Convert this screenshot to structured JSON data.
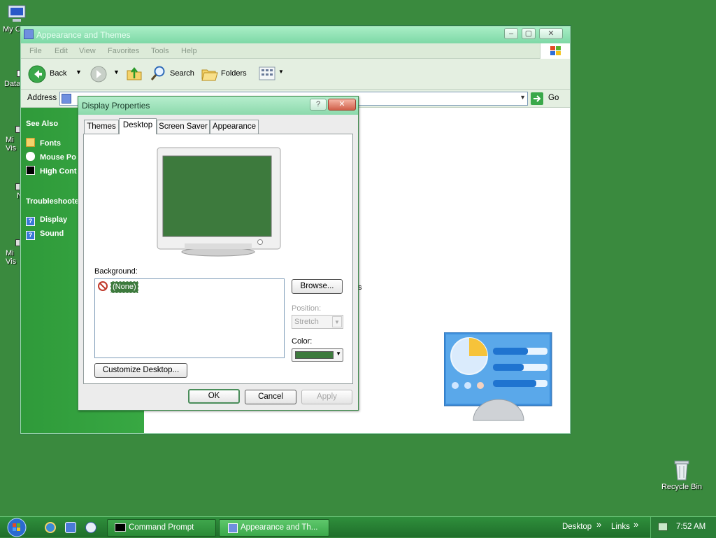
{
  "desktop": {
    "icons": [
      {
        "name": "my-computer",
        "label": "My C"
      },
      {
        "name": "data",
        "label": "Data"
      },
      {
        "name": "mi-1",
        "label": "Mi\nVis"
      },
      {
        "name": "n",
        "label": "N"
      },
      {
        "name": "mi-2",
        "label": "Mi\nVis"
      }
    ],
    "recycle_bin": "Recycle Bin",
    "background_color": "#3a8a3e"
  },
  "explorer": {
    "title": "Appearance and Themes",
    "menu": [
      "File",
      "Edit",
      "View",
      "Favorites",
      "Tools",
      "Help"
    ],
    "toolbar": {
      "back": "Back",
      "search": "Search",
      "folders": "Folders"
    },
    "address_label": "Address",
    "go_label": "Go",
    "see_also": {
      "heading": "See Also",
      "items": [
        "Fonts",
        "Mouse Po",
        "High Cont"
      ]
    },
    "troubleshooters": {
      "heading": "Troubleshoote",
      "items": [
        "Display",
        "Sound"
      ]
    },
    "stray_text": "s"
  },
  "dialog": {
    "title": "Display Properties",
    "help_btn": "?",
    "close_btn": "✕",
    "tabs": [
      "Themes",
      "Desktop",
      "Screen Saver",
      "Appearance"
    ],
    "selected_tab": "Desktop",
    "background_label": "Background:",
    "background_items": [
      "(None)"
    ],
    "browse": "Browse...",
    "position_label": "Position:",
    "position_value": "Stretch",
    "color_label": "Color:",
    "color_value": "#3d7a3d",
    "customize": "Customize Desktop...",
    "ok": "OK",
    "cancel": "Cancel",
    "apply": "Apply"
  },
  "taskbar": {
    "tasks": [
      "Command Prompt",
      "Appearance and Th..."
    ],
    "desktop": "Desktop",
    "links": "Links",
    "chev": "»",
    "clock": "7:52 AM"
  }
}
